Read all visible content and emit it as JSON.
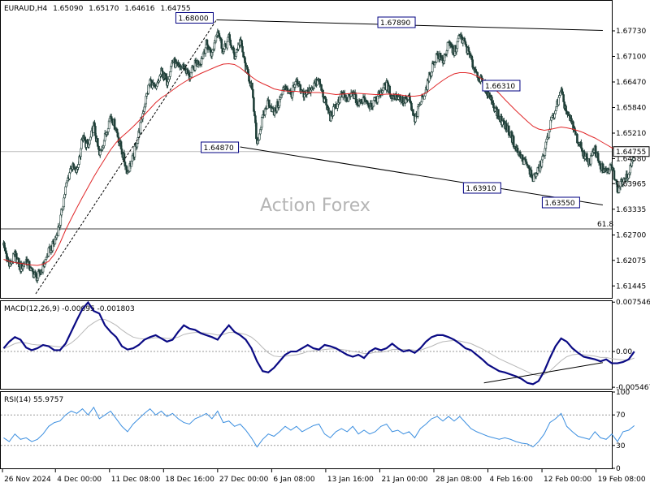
{
  "chart_data": {
    "type": "candlestick",
    "symbol_header": {
      "symbol": "EURAUD,H4",
      "open": "1.65090",
      "high": "1.65170",
      "low": "1.64616",
      "close": "1.64755"
    },
    "watermark": "Action Forex",
    "main_panel": {
      "ylim": [
        1.6115,
        1.6845
      ],
      "y_ticks": [
        "1.67730",
        "1.67100",
        "1.66470",
        "1.65840",
        "1.65210",
        "1.64580",
        "1.63965",
        "1.63335",
        "1.62700",
        "1.62075",
        "1.61445"
      ],
      "current_price_label": "1.64755",
      "current_price": 1.64755,
      "fib_level": {
        "label": "61.8",
        "value": 1.6285
      },
      "swing_labels": [
        {
          "text": "1.68000",
          "x": 38.3,
          "y": 1.68
        },
        {
          "text": "1.67890",
          "x": 73.3,
          "y": 1.6789
        },
        {
          "text": "1.66310",
          "x": 91.9,
          "y": 1.6631
        },
        {
          "text": "1.64870",
          "x": 42.5,
          "y": 1.6487
        },
        {
          "text": "1.63910",
          "x": 88.5,
          "y": 1.6391
        },
        {
          "text": "1.63550",
          "x": 102.5,
          "y": 1.6355
        }
      ],
      "trend_lines": [
        {
          "name": "upper-trendline",
          "from": [
            38.3,
            1.68
          ],
          "to": [
            106.9,
            1.6774
          ]
        },
        {
          "name": "lower-trendline",
          "from": [
            42.5,
            1.6487
          ],
          "to": [
            106.9,
            1.6344
          ]
        },
        {
          "name": "rising-dashed-channel",
          "from": [
            6.2,
            1.6125
          ],
          "to": [
            38.3,
            1.68
          ]
        }
      ],
      "close_series": [
        1.6245,
        1.6195,
        1.6222,
        1.6188,
        1.6208,
        1.6179,
        1.6165,
        1.6192,
        1.6228,
        1.625,
        1.63,
        1.6385,
        1.644,
        1.6425,
        1.651,
        1.6485,
        1.654,
        1.6465,
        1.6512,
        1.6565,
        1.653,
        1.6475,
        1.6424,
        1.6462,
        1.652,
        1.659,
        1.665,
        1.6625,
        1.6672,
        1.6648,
        1.67,
        1.668,
        1.6685,
        1.666,
        1.669,
        1.67,
        1.674,
        1.6715,
        1.678,
        1.672,
        1.6755,
        1.671,
        1.675,
        1.668,
        1.664,
        1.6495,
        1.656,
        1.66,
        1.657,
        1.66,
        1.664,
        1.6615,
        1.6645,
        1.6618,
        1.662,
        1.664,
        1.665,
        1.66,
        1.656,
        1.6588,
        1.6615,
        1.66,
        1.662,
        1.659,
        1.661,
        1.659,
        1.66,
        1.6625,
        1.664,
        1.661,
        1.6612,
        1.66,
        1.6605,
        1.655,
        1.6595,
        1.663,
        1.668,
        1.6715,
        1.67,
        1.674,
        1.672,
        1.676,
        1.674,
        1.67,
        1.6668,
        1.6645,
        1.662,
        1.659,
        1.656,
        1.654,
        1.652,
        1.648,
        1.646,
        1.644,
        1.641,
        1.643,
        1.647,
        1.654,
        1.658,
        1.662,
        1.657,
        1.654,
        1.65,
        1.647,
        1.645,
        1.648,
        1.644,
        1.642,
        1.644,
        1.638,
        1.641,
        1.642,
        1.6475
      ],
      "ma_series": [
        1.621,
        1.6205,
        1.6202,
        1.62,
        1.6198,
        1.6196,
        1.6195,
        1.6198,
        1.6205,
        1.6222,
        1.625,
        1.6282,
        1.631,
        1.6337,
        1.6363,
        1.6388,
        1.6413,
        1.6436,
        1.6458,
        1.648,
        1.6498,
        1.6512,
        1.6524,
        1.6537,
        1.6551,
        1.6566,
        1.6581,
        1.6596,
        1.6608,
        1.6617,
        1.6627,
        1.6637,
        1.6646,
        1.6654,
        1.6661,
        1.6668,
        1.6674,
        1.668,
        1.6686,
        1.6691,
        1.6692,
        1.669,
        1.6682,
        1.6671,
        1.666,
        1.665,
        1.6643,
        1.6637,
        1.663,
        1.6627,
        1.6625,
        1.6624,
        1.6624,
        1.6622,
        1.6621,
        1.6621,
        1.6621,
        1.662,
        1.6618,
        1.6616,
        1.6617,
        1.6618,
        1.6619,
        1.6619,
        1.6618,
        1.6617,
        1.6616,
        1.6616,
        1.6617,
        1.6617,
        1.6616,
        1.6614,
        1.6612,
        1.6612,
        1.6614,
        1.662,
        1.663,
        1.6641,
        1.6651,
        1.666,
        1.6667,
        1.667,
        1.667,
        1.6668,
        1.6662,
        1.6654,
        1.6644,
        1.6632,
        1.6619,
        1.6604,
        1.659,
        1.6576,
        1.6563,
        1.655,
        1.6538,
        1.6531,
        1.6528,
        1.653,
        1.6533,
        1.6536,
        1.6534,
        1.6531,
        1.6527,
        1.6522,
        1.6515,
        1.6509,
        1.6501,
        1.6493,
        1.6485,
        1.6478,
        1.6472,
        1.6467,
        1.647
      ]
    },
    "macd_panel": {
      "label": "MACD(12,26,9) -0.00095 -0.001803",
      "ylim": [
        -0.0057,
        0.0077
      ],
      "y_ticks": [
        "0.007546",
        "0.00",
        "-0.005467"
      ],
      "macd_series": [
        0.0005,
        0.0015,
        0.0022,
        0.0018,
        0.0006,
        0.0002,
        0.0005,
        0.001,
        0.0008,
        0.0002,
        0.0002,
        0.0012,
        0.003,
        0.0048,
        0.0065,
        0.0075,
        0.0062,
        0.0058,
        0.004,
        0.003,
        0.0022,
        0.0008,
        0.0003,
        0.0005,
        0.001,
        0.0018,
        0.0022,
        0.0025,
        0.002,
        0.0015,
        0.0018,
        0.003,
        0.004,
        0.0035,
        0.0033,
        0.0028,
        0.0025,
        0.0022,
        0.0018,
        0.003,
        0.004,
        0.003,
        0.0025,
        0.0018,
        0.0005,
        -0.0015,
        -0.003,
        -0.0032,
        -0.0025,
        -0.0015,
        -0.0005,
        0.0,
        0.0,
        0.0005,
        0.001,
        0.0005,
        0.0003,
        0.001,
        0.0008,
        0.0005,
        0.0,
        -0.0005,
        -0.0008,
        -0.0005,
        -0.001,
        0.0,
        0.0005,
        0.0002,
        0.0005,
        0.0012,
        0.0005,
        0.0,
        0.0002,
        -0.0002,
        0.0005,
        0.0015,
        0.0022,
        0.0025,
        0.0025,
        0.0022,
        0.0018,
        0.0012,
        0.0005,
        0.0002,
        -0.0005,
        -0.0012,
        -0.002,
        -0.0025,
        -0.003,
        -0.0032,
        -0.0035,
        -0.0038,
        -0.0042,
        -0.0048,
        -0.005,
        -0.0045,
        -0.003,
        -0.001,
        0.0008,
        0.002,
        0.0015,
        0.0005,
        -0.0002,
        -0.0008,
        -0.001,
        -0.0012,
        -0.0015,
        -0.0012,
        -0.0018,
        -0.0018,
        -0.0016,
        -0.0012,
        0.0
      ],
      "signal_series": [
        0.0004,
        0.0008,
        0.0012,
        0.0014,
        0.0013,
        0.0011,
        0.001,
        0.001,
        0.0009,
        0.0008,
        0.0007,
        0.0008,
        0.0013,
        0.002,
        0.0029,
        0.0038,
        0.0044,
        0.0049,
        0.0049,
        0.0045,
        0.004,
        0.0033,
        0.0027,
        0.0022,
        0.002,
        0.0019,
        0.002,
        0.0021,
        0.0021,
        0.002,
        0.002,
        0.0022,
        0.0026,
        0.0028,
        0.0029,
        0.0029,
        0.0028,
        0.0027,
        0.0025,
        0.0026,
        0.0029,
        0.0029,
        0.0028,
        0.0026,
        0.0022,
        0.0015,
        0.0006,
        -0.0002,
        -0.0007,
        -0.0008,
        -0.0007,
        -0.0006,
        -0.0005,
        -0.0003,
        0.0,
        0.0001,
        0.0002,
        0.0003,
        0.0004,
        0.0004,
        0.0003,
        0.0002,
        0.0,
        -0.0001,
        -0.0003,
        -0.0003,
        -0.0001,
        -0.0001,
        0.0,
        0.0003,
        0.0003,
        0.0003,
        0.0003,
        0.0002,
        0.0002,
        0.0005,
        0.0008,
        0.0012,
        0.0015,
        0.0016,
        0.0017,
        0.0016,
        0.0014,
        0.0012,
        0.0008,
        0.0004,
        -0.0001,
        -0.0006,
        -0.0011,
        -0.0015,
        -0.0019,
        -0.0023,
        -0.0027,
        -0.0031,
        -0.0035,
        -0.0037,
        -0.0035,
        -0.003,
        -0.0022,
        -0.0014,
        -0.0008,
        -0.0005,
        -0.0004,
        -0.0005,
        -0.0006,
        -0.0007,
        -0.0009,
        -0.0009,
        -0.0011,
        -0.0012,
        -0.0013,
        -0.0013,
        -0.001
      ],
      "trend_line": {
        "from": [
          85.8,
          -0.0048
        ],
        "to": [
          106.9,
          -0.0017
        ]
      }
    },
    "rsi_panel": {
      "label": "RSI(14) 55.9757",
      "ylim": [
        0,
        100
      ],
      "y_ticks": [
        "100",
        "70",
        "30",
        "0"
      ],
      "levels": [
        70,
        30
      ],
      "rsi_series": [
        40,
        35,
        45,
        38,
        40,
        35,
        38,
        45,
        55,
        60,
        62,
        70,
        75,
        72,
        78,
        70,
        80,
        65,
        70,
        75,
        65,
        55,
        48,
        58,
        65,
        72,
        78,
        70,
        75,
        68,
        72,
        65,
        60,
        58,
        65,
        68,
        72,
        65,
        75,
        60,
        62,
        55,
        58,
        50,
        40,
        28,
        38,
        45,
        42,
        48,
        55,
        50,
        55,
        48,
        52,
        56,
        58,
        45,
        40,
        48,
        52,
        48,
        55,
        45,
        50,
        45,
        48,
        55,
        58,
        48,
        50,
        45,
        48,
        40,
        52,
        58,
        65,
        68,
        62,
        68,
        62,
        68,
        60,
        52,
        48,
        45,
        42,
        40,
        38,
        40,
        38,
        35,
        33,
        32,
        28,
        35,
        45,
        60,
        65,
        72,
        55,
        48,
        42,
        40,
        38,
        48,
        40,
        38,
        45,
        35,
        48,
        50,
        56
      ]
    },
    "x_axis": {
      "range": [
        0,
        108.5
      ],
      "ticks": [
        {
          "label": "26 Nov 2024",
          "x": 0.3
        },
        {
          "label": "4 Dec 00:00",
          "x": 9.7
        },
        {
          "label": "11 Dec 08:00",
          "x": 19.3
        },
        {
          "label": "18 Dec 16:00",
          "x": 28.9
        },
        {
          "label": "27 Dec 00:00",
          "x": 38.5
        },
        {
          "label": "6 Jan 08:00",
          "x": 48.1
        },
        {
          "label": "13 Jan 16:00",
          "x": 57.7
        },
        {
          "label": "21 Jan 00:00",
          "x": 67.3
        },
        {
          "label": "28 Jan 08:00",
          "x": 76.9
        },
        {
          "label": "4 Feb 16:00",
          "x": 86.5
        },
        {
          "label": "12 Feb 00:00",
          "x": 96.1
        },
        {
          "label": "19 Feb 08:00",
          "x": 105.7
        }
      ]
    },
    "colors": {
      "candle": "#1f3f38",
      "ma": "#e0282a",
      "macd": "#0a0a84",
      "signal": "#b8b8b8",
      "rsi": "#3c8fe0",
      "label_border": "#000080",
      "grid": "#bbbbbb",
      "dotted": "#999999"
    }
  }
}
